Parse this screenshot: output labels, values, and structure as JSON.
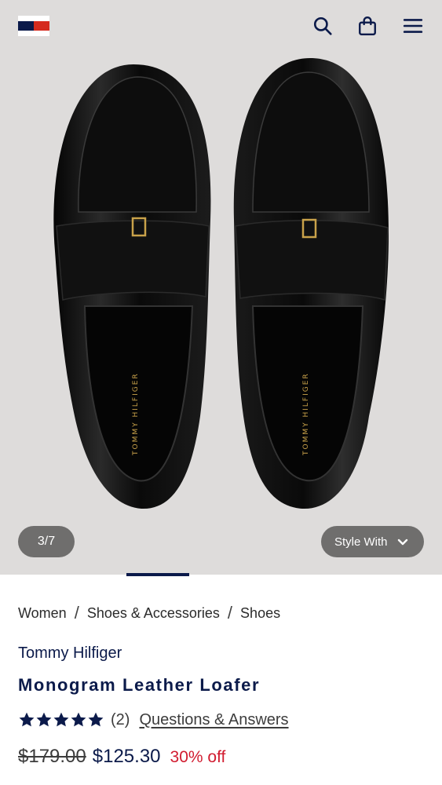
{
  "header": {
    "logo_icon": "tommy-hilfiger-flag-logo",
    "search_icon": "search-icon",
    "bag_icon": "shopping-bag-icon",
    "menu_icon": "hamburger-menu-icon"
  },
  "gallery": {
    "counter": "3/7",
    "style_with_label": "Style With",
    "current_index": 3,
    "total": 7
  },
  "breadcrumb": {
    "items": [
      "Women",
      "Shoes & Accessories",
      "Shoes"
    ],
    "separator": "/"
  },
  "product": {
    "brand": "Tommy Hilfiger",
    "name": "Monogram Leather Loafer",
    "rating_count": "(2)",
    "rating_stars": 5,
    "qa_link": "Questions & Answers",
    "original_price": "$179.00",
    "sale_price": "$125.30",
    "discount": "30% off"
  },
  "colors": {
    "navy": "#0b1a4a",
    "red": "#d52b1e",
    "discount_red": "#d11b2f",
    "pill_bg": "#6f6e6d",
    "image_bg": "#dedcdb"
  }
}
